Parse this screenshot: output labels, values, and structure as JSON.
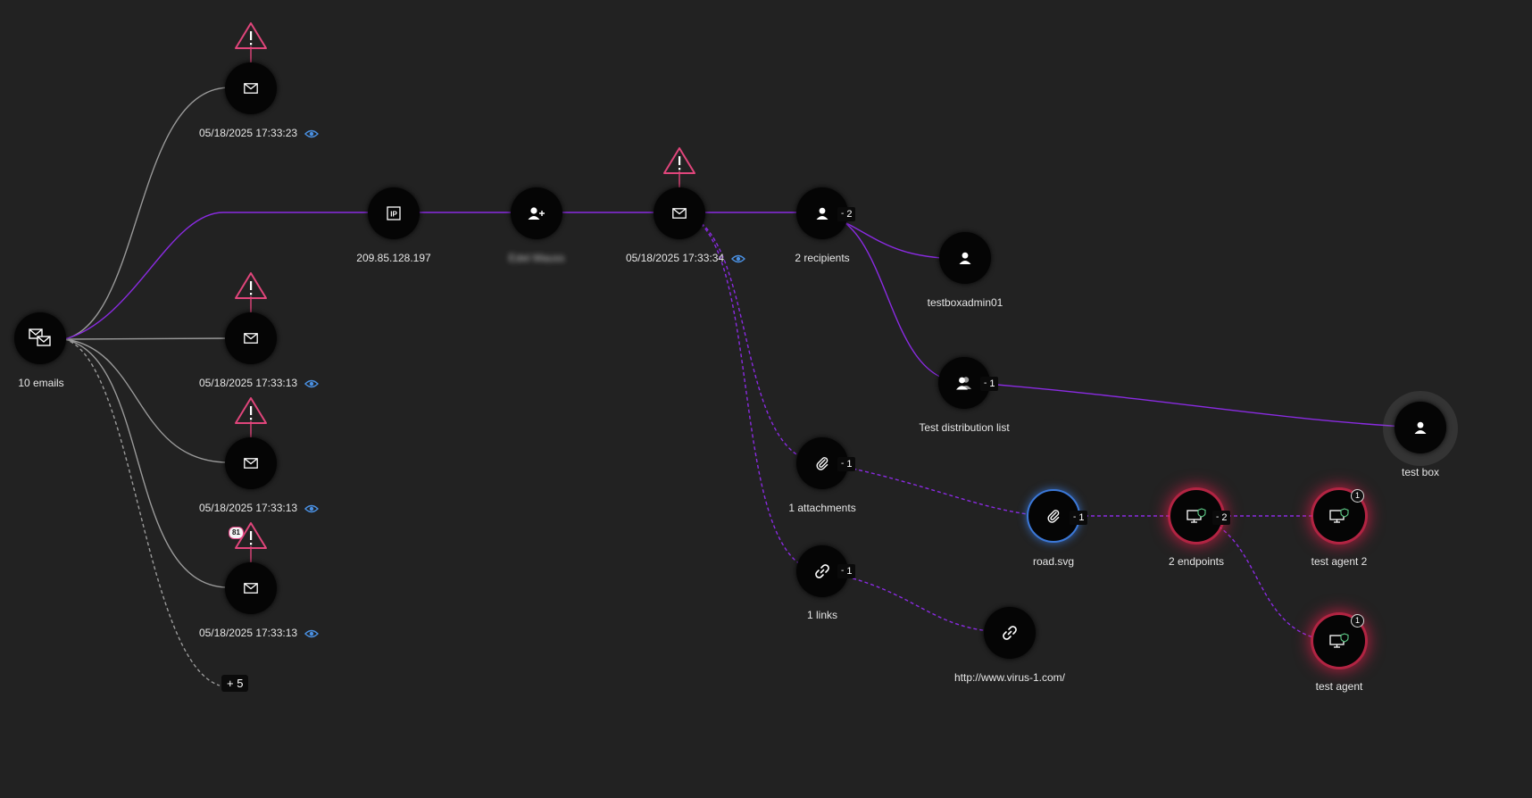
{
  "root": {
    "label": "10 emails",
    "icon": "multiple-emails-icon"
  },
  "emails": [
    {
      "timestamp": "05/18/2025 17:33:23",
      "warning": true,
      "view_icon": "eye-icon"
    },
    {
      "timestamp": "05/18/2025 17:33:13",
      "warning": true,
      "view_icon": "eye-icon"
    },
    {
      "timestamp": "05/18/2025 17:33:13",
      "warning": true,
      "view_icon": "eye-icon"
    },
    {
      "timestamp": "05/18/2025 17:33:13",
      "warning": true,
      "chip": "81",
      "view_icon": "eye-icon"
    }
  ],
  "more_button": "+ 5",
  "ip": {
    "label": "209.85.128.197",
    "icon": "ip-icon"
  },
  "sender": {
    "label": "Edel Mauss",
    "redacted": true,
    "icon": "add-user-icon"
  },
  "main_email": {
    "timestamp": "05/18/2025 17:33:34",
    "warning": true,
    "view_icon": "eye-icon"
  },
  "recipients": {
    "label": "2 recipients",
    "count": "2",
    "icon": "user-icon"
  },
  "testboxadmin": {
    "label": "testboxadmin01",
    "icon": "user-icon"
  },
  "distribution": {
    "label": "Test distribution list",
    "count": "1",
    "icon": "group-icon"
  },
  "testbox": {
    "label": "test box",
    "icon": "user-icon"
  },
  "attachments": {
    "label": "1 attachments",
    "count": "1",
    "icon": "paperclip-icon"
  },
  "links": {
    "label": "1 links",
    "count": "1",
    "icon": "link-icon"
  },
  "road": {
    "label": "road.svg",
    "count": "1",
    "icon": "paperclip-icon"
  },
  "virus_link": {
    "label": "http://www.virus-1.com/",
    "icon": "link-icon"
  },
  "endpoints": {
    "label": "2 endpoints",
    "count": "2",
    "icon": "endpoint-icon"
  },
  "agent2": {
    "label": "test agent 2",
    "badge": "1",
    "icon": "endpoint-icon"
  },
  "agent1": {
    "label": "test agent",
    "badge": "1",
    "icon": "endpoint-icon"
  },
  "colors": {
    "background": "#222222",
    "edge_gray": "#9a9a9a",
    "edge_purple": "#8a2be2",
    "warning": "#e0457b",
    "danger_glow": "#e61e4b",
    "selected": "#3b78d8",
    "eye": "#4a90e2"
  }
}
